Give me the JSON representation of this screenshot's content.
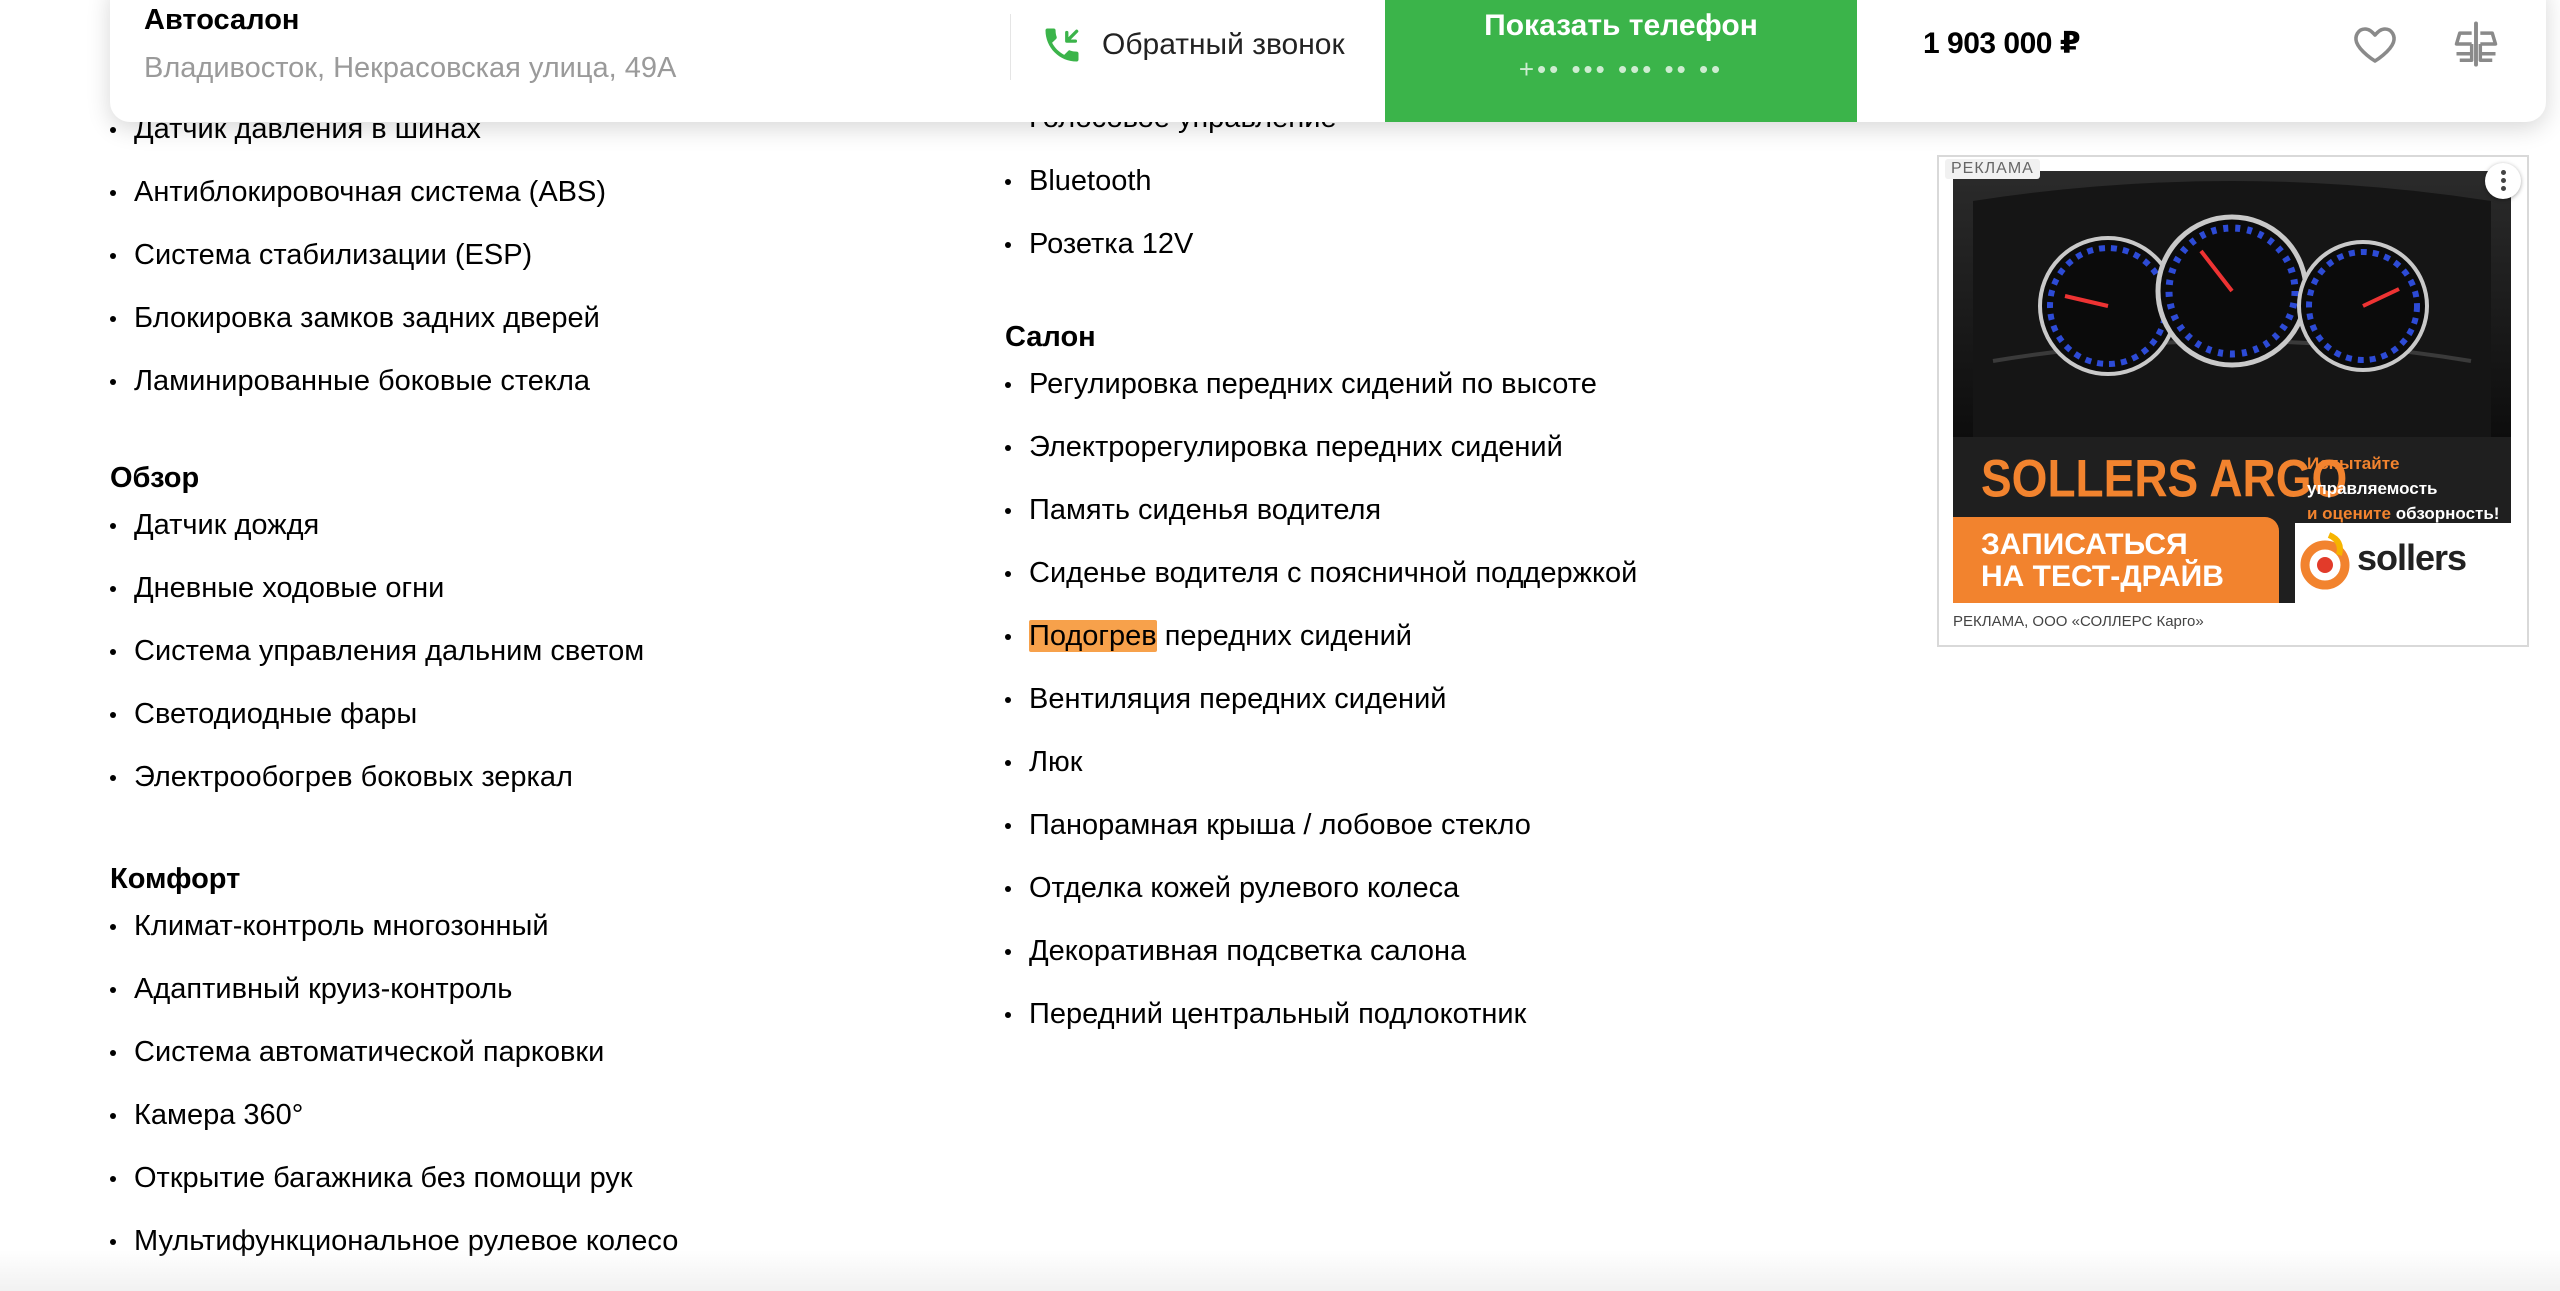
{
  "header": {
    "seller_name": "Автосалон",
    "seller_address": "Владивосток, Некрасовская улица, 49А",
    "callback_label": "Обратный звонок",
    "show_phone_label": "Показать телефон",
    "phone_masked": "+•• ••• ••• •• ••",
    "price": "1 903 000 ₽",
    "icons": [
      "callback-phone-icon",
      "heart-icon",
      "compare-icon"
    ],
    "accent_color": "#3bb44a"
  },
  "left_column": {
    "top_items": [
      "Датчик давления в шинах",
      "Антиблокировочная система (ABS)",
      "Система стабилизации (ESP)",
      "Блокировка замков задних дверей",
      "Ламинированные боковые стекла"
    ],
    "review": {
      "title": "Обзор",
      "items": [
        "Датчик дождя",
        "Дневные ходовые огни",
        "Система управления дальним светом",
        "Светодиодные фары",
        "Электрообогрев боковых зеркал"
      ]
    },
    "comfort": {
      "title": "Комфорт",
      "items": [
        "Климат-контроль многозонный",
        "Адаптивный круиз-контроль",
        "Система автоматической парковки",
        "Камера 360°",
        "Открытие багажника без помощи рук",
        "Мультифункциональное рулевое колесо"
      ]
    }
  },
  "middle_column": {
    "top_items": [
      "Голосовое управление",
      "Bluetooth",
      "Розетка 12V"
    ],
    "salon": {
      "title": "Салон",
      "items": [
        "Регулировка передних сидений по высоте",
        "Электрорегулировка передних сидений",
        "Память сиденья водителя",
        "Сиденье водителя с поясничной поддержкой",
        "Подогрев передних сидений",
        "Вентиляция передних сидений",
        "Люк",
        "Панорамная крыша / лобовое стекло",
        "Отделка кожей рулевого колеса",
        "Декоративная подсветка салона",
        "Передний центральный подлокотник"
      ],
      "highlight_word": "Подогрев",
      "highlight_rest": " передних сидений",
      "highlight_color": "#f7a14b"
    }
  },
  "ad": {
    "top_label": "РЕКЛАМА",
    "brand": "SOLLERS ARGO",
    "side_line1": "Испытайте",
    "side_line2": "управляемость",
    "side_line3_a": "и оцените ",
    "side_line3_b": "обзорность!",
    "cta_line1": "ЗАПИСАТЬСЯ",
    "cta_line2": "НА ТЕСТ-ДРАЙВ",
    "logo_word": "sollers",
    "footer": "РЕКЛАМА, ООО «СОЛЛЕРС Карго»",
    "brand_color": "#f2832e"
  }
}
